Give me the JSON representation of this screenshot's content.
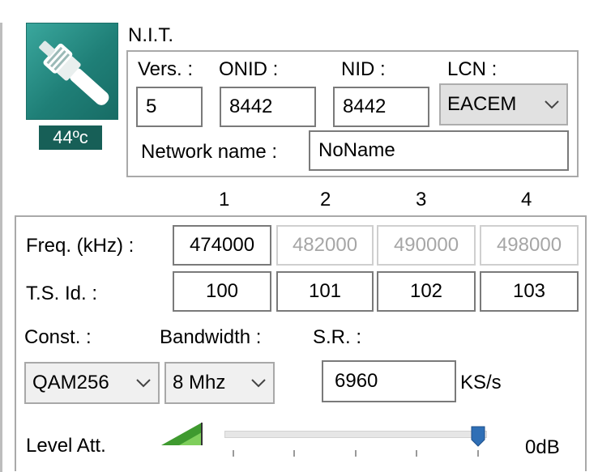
{
  "temperature": "44ºc",
  "nit": {
    "title": "N.I.T.",
    "vers_label": "Vers. :",
    "onid_label": "ONID :",
    "nid_label": "NID :",
    "lcn_label": "LCN :",
    "vers_value": "5",
    "onid_value": "8442",
    "nid_value": "8442",
    "lcn_value": "EACEM",
    "network_name_label": "Network name :",
    "network_name_value": "NoName"
  },
  "columns": [
    "1",
    "2",
    "3",
    "4"
  ],
  "freq": {
    "label": "Freq. (kHz) :",
    "values": [
      "474000",
      "482000",
      "490000",
      "498000"
    ],
    "enabled": [
      true,
      false,
      false,
      false
    ]
  },
  "tsid": {
    "label": "T.S. Id. :",
    "values": [
      "100",
      "101",
      "102",
      "103"
    ]
  },
  "const": {
    "label": "Const. :",
    "value": "QAM256"
  },
  "bandwidth": {
    "label": "Bandwidth :",
    "value": "8 Mhz"
  },
  "symbol_rate": {
    "label": "S.R. :",
    "value": "6960",
    "unit": "KS/s"
  },
  "level_att": {
    "label": "Level Att.",
    "value_text": "0dB",
    "slider_fraction": 1.0
  },
  "icons": [
    "coax-connector-icon",
    "signal-level-icon",
    "chevron-down-icon"
  ],
  "colors": {
    "teal": "#2a9088",
    "badge": "#175f57",
    "slider_thumb": "#2f6fb6",
    "signal_green": "#3f9a2f"
  }
}
